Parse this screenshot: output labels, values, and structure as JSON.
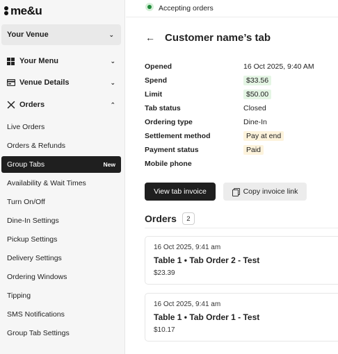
{
  "brand": {
    "logo_text": "me&u"
  },
  "sidebar": {
    "venue_select": "Your Venue",
    "groups": [
      {
        "label": "Your Menu",
        "icon": "grid-icon",
        "expanded": false
      },
      {
        "label": "Venue Details",
        "icon": "card-icon",
        "expanded": false
      },
      {
        "label": "Orders",
        "icon": "cutlery-icon",
        "expanded": true
      }
    ],
    "items": [
      {
        "label": "Live Orders"
      },
      {
        "label": "Orders & Refunds"
      },
      {
        "label": "Group Tabs",
        "badge": "New",
        "active": true
      },
      {
        "label": "Availability & Wait Times"
      },
      {
        "label": "Turn On/Off"
      },
      {
        "label": "Dine-In Settings"
      },
      {
        "label": "Pickup Settings"
      },
      {
        "label": "Delivery Settings"
      },
      {
        "label": "Ordering Windows"
      },
      {
        "label": "Tipping"
      },
      {
        "label": "SMS Notifications"
      },
      {
        "label": "Group Tab Settings"
      }
    ]
  },
  "status": {
    "text": "Accepting orders",
    "color": "#1f8a3a"
  },
  "page": {
    "title": "Customer name’s tab"
  },
  "details": [
    {
      "label": "Opened",
      "value": "16 Oct 2025, 9:40 AM",
      "style": "plain"
    },
    {
      "label": "Spend",
      "value": "$33.56",
      "style": "green"
    },
    {
      "label": "Limit",
      "value": "$50.00",
      "style": "green"
    },
    {
      "label": "Tab status",
      "value": "Closed",
      "style": "plain"
    },
    {
      "label": "Ordering type",
      "value": "Dine-In",
      "style": "plain"
    },
    {
      "label": "Settlement method",
      "value": "Pay at end",
      "style": "yellow"
    },
    {
      "label": "Payment status",
      "value": "Paid",
      "style": "yellow"
    },
    {
      "label": "Mobile phone",
      "value": "",
      "style": "plain"
    }
  ],
  "actions": {
    "view_invoice": "View tab invoice",
    "copy_link": "Copy invoice link"
  },
  "orders": {
    "title": "Orders",
    "count": "2",
    "list": [
      {
        "time": "16 Oct 2025, 9:41 am",
        "name": "Table 1 • Tab Order 2 - Test",
        "amount": "$23.39"
      },
      {
        "time": "16 Oct 2025, 9:41 am",
        "name": "Table 1 • Tab Order 1 - Test",
        "amount": "$10.17"
      }
    ]
  }
}
